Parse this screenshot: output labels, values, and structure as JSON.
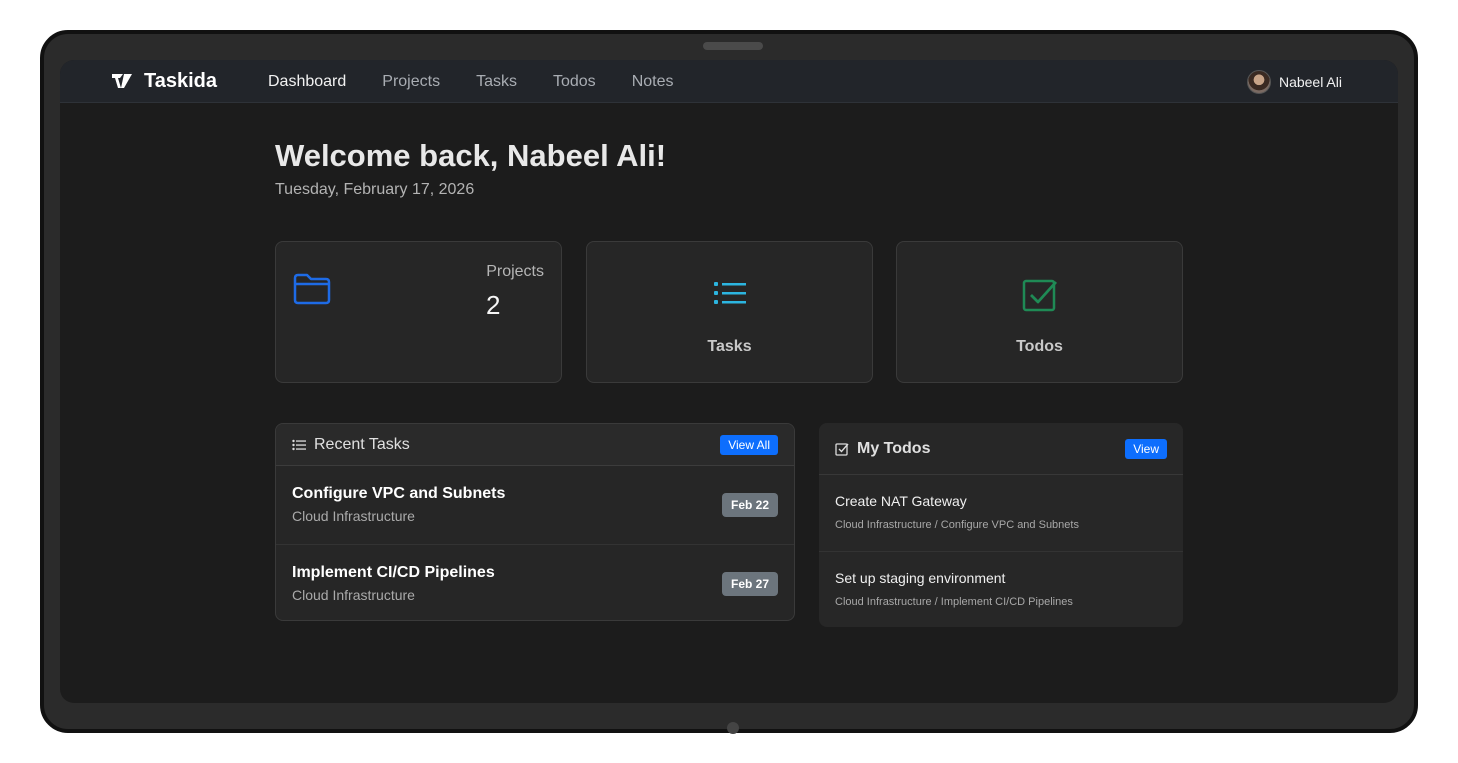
{
  "navbar": {
    "brand": "Taskida",
    "links": [
      "Dashboard",
      "Projects",
      "Tasks",
      "Todos",
      "Notes"
    ],
    "active": "Dashboard",
    "user_name": "Nabeel Ali"
  },
  "welcome": {
    "heading": "Welcome back, Nabeel Ali!",
    "date": "Tuesday, February 17, 2026"
  },
  "stats": {
    "projects_label": "Projects",
    "projects_count": "2",
    "tasks_label": "Tasks",
    "todos_label": "Todos"
  },
  "recent_tasks": {
    "title": "Recent Tasks",
    "view_all_label": "View All",
    "items": [
      {
        "title": "Configure VPC and Subnets",
        "project": "Cloud Infrastructure",
        "due": "Feb 22"
      },
      {
        "title": "Implement CI/CD Pipelines",
        "project": "Cloud Infrastructure",
        "due": "Feb 27"
      }
    ]
  },
  "my_todos": {
    "title": "My Todos",
    "view_label": "View",
    "items": [
      {
        "title": "Create NAT Gateway",
        "path": "Cloud Infrastructure / Configure VPC and Subnets"
      },
      {
        "title": "Set up staging environment",
        "path": "Cloud Infrastructure / Implement CI/CD Pipelines"
      }
    ]
  },
  "colors": {
    "accent_blue": "#0d6efd",
    "folder_icon": "#1e6be6",
    "tasks_icon": "#2cb5e0",
    "todos_icon": "#1f8a55",
    "badge": "#6c757d"
  },
  "icons": [
    "taskida-logo-icon",
    "folder-icon",
    "list-icon",
    "check-square-icon",
    "avatar"
  ]
}
